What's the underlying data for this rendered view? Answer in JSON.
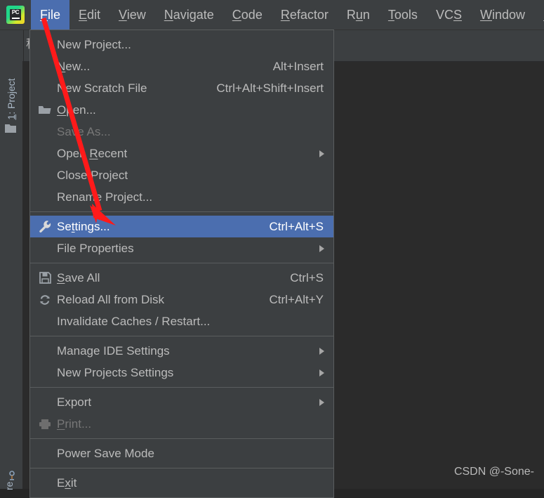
{
  "app": {
    "logo_text": "PC",
    "logo_name": "pycharm-logo"
  },
  "menubar": {
    "items": [
      {
        "label": "File",
        "mnemonic": "F",
        "active": true
      },
      {
        "label": "Edit",
        "mnemonic": "E",
        "active": false
      },
      {
        "label": "View",
        "mnemonic": "V",
        "active": false
      },
      {
        "label": "Navigate",
        "mnemonic": "N",
        "active": false
      },
      {
        "label": "Code",
        "mnemonic": "C",
        "active": false
      },
      {
        "label": "Refactor",
        "mnemonic": "R",
        "active": false
      },
      {
        "label": "Run",
        "mnemonic": "u",
        "active": false
      },
      {
        "label": "Tools",
        "mnemonic": "T",
        "active": false
      },
      {
        "label": "VCS",
        "mnemonic": "S",
        "active": false
      },
      {
        "label": "Window",
        "mnemonic": "W",
        "active": false
      },
      {
        "label": "Help",
        "mnemonic": "H",
        "active": false
      }
    ]
  },
  "toolbar": {
    "project_label": "程序"
  },
  "sidebar": {
    "tab_label": "1: Project",
    "tab_mnemonic": "1",
    "folder_icon": "folder-icon",
    "bottom_label": "re",
    "bottom_icon": "structure-icon"
  },
  "file_menu": {
    "items": [
      {
        "label": "New Project...",
        "icon": null,
        "accel": "",
        "submenu": false,
        "disabled": false,
        "selected": false,
        "mnemonic": ""
      },
      {
        "label": "New...",
        "icon": null,
        "accel": "Alt+Insert",
        "submenu": false,
        "disabled": false,
        "selected": false,
        "mnemonic": "N"
      },
      {
        "label": "New Scratch File",
        "icon": null,
        "accel": "Ctrl+Alt+Shift+Insert",
        "submenu": false,
        "disabled": false,
        "selected": false,
        "mnemonic": ""
      },
      {
        "label": "Open...",
        "icon": "folder-icon",
        "accel": "",
        "submenu": false,
        "disabled": false,
        "selected": false,
        "mnemonic": "O"
      },
      {
        "label": "Save As...",
        "icon": null,
        "accel": "",
        "submenu": false,
        "disabled": true,
        "selected": false,
        "mnemonic": ""
      },
      {
        "label": "Open Recent",
        "icon": null,
        "accel": "",
        "submenu": true,
        "disabled": false,
        "selected": false,
        "mnemonic": "R"
      },
      {
        "label": "Close Project",
        "icon": null,
        "accel": "",
        "submenu": false,
        "disabled": false,
        "selected": false,
        "mnemonic": ""
      },
      {
        "label": "Rename Project...",
        "icon": null,
        "accel": "",
        "submenu": false,
        "disabled": false,
        "selected": false,
        "mnemonic": ""
      },
      {
        "separator": true
      },
      {
        "label": "Settings...",
        "icon": "wrench-icon",
        "accel": "Ctrl+Alt+S",
        "submenu": false,
        "disabled": false,
        "selected": true,
        "mnemonic": "t"
      },
      {
        "label": "File Properties",
        "icon": null,
        "accel": "",
        "submenu": true,
        "disabled": false,
        "selected": false,
        "mnemonic": ""
      },
      {
        "separator": true
      },
      {
        "label": "Save All",
        "icon": "save-icon",
        "accel": "Ctrl+S",
        "submenu": false,
        "disabled": false,
        "selected": false,
        "mnemonic": "S"
      },
      {
        "label": "Reload All from Disk",
        "icon": "refresh-icon",
        "accel": "Ctrl+Alt+Y",
        "submenu": false,
        "disabled": false,
        "selected": false,
        "mnemonic": ""
      },
      {
        "label": "Invalidate Caches / Restart...",
        "icon": null,
        "accel": "",
        "submenu": false,
        "disabled": false,
        "selected": false,
        "mnemonic": ""
      },
      {
        "separator": true
      },
      {
        "label": "Manage IDE Settings",
        "icon": null,
        "accel": "",
        "submenu": true,
        "disabled": false,
        "selected": false,
        "mnemonic": ""
      },
      {
        "label": "New Projects Settings",
        "icon": null,
        "accel": "",
        "submenu": true,
        "disabled": false,
        "selected": false,
        "mnemonic": ""
      },
      {
        "separator": true
      },
      {
        "label": "Export",
        "icon": null,
        "accel": "",
        "submenu": true,
        "disabled": false,
        "selected": false,
        "mnemonic": ""
      },
      {
        "label": "Print...",
        "icon": "printer-icon",
        "accel": "",
        "submenu": false,
        "disabled": true,
        "selected": false,
        "mnemonic": "P"
      },
      {
        "separator": true
      },
      {
        "label": "Power Save Mode",
        "icon": null,
        "accel": "",
        "submenu": false,
        "disabled": false,
        "selected": false,
        "mnemonic": ""
      },
      {
        "separator": true
      },
      {
        "label": "Exit",
        "icon": null,
        "accel": "",
        "submenu": false,
        "disabled": false,
        "selected": false,
        "mnemonic": "x"
      }
    ]
  },
  "annotation": {
    "arrow_color": "#FF1A1A",
    "arrow_name": "red-pointer-arrow"
  },
  "watermark": {
    "text": "CSDN @-Sone-"
  },
  "colors": {
    "menu_bg": "#3c3f41",
    "selection": "#4b6eaf",
    "editor_bg": "#2b2b2b",
    "text": "#bbbbbb",
    "disabled_text": "#777777"
  }
}
